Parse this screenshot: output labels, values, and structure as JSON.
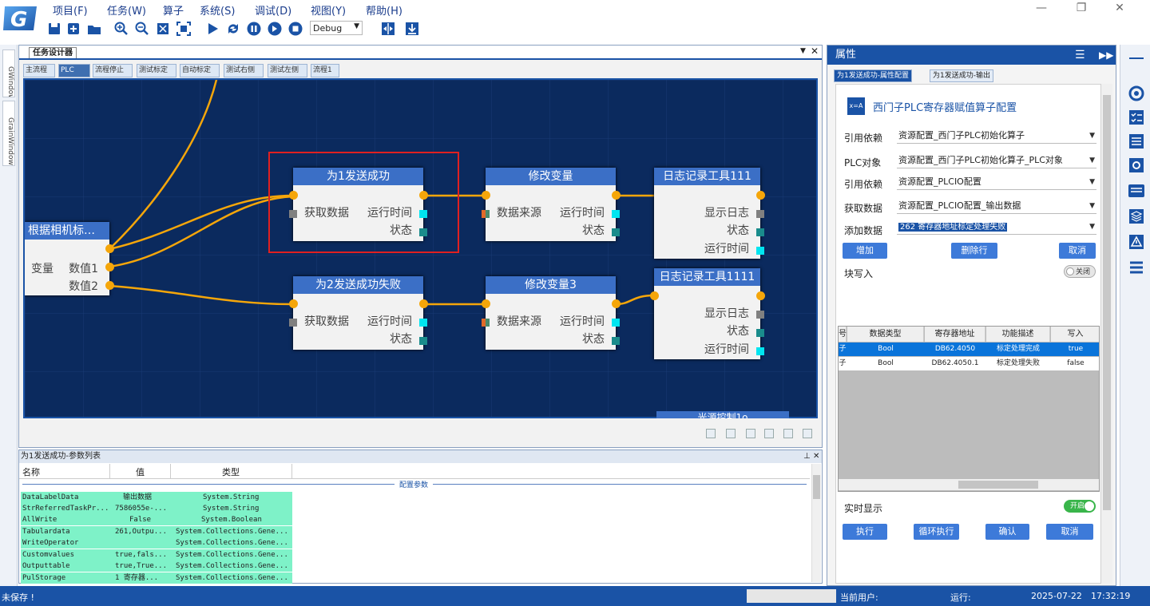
{
  "menu": {
    "items": [
      "项目(F)",
      "任务(W)",
      "算子",
      "系统(S)",
      "调试(D)",
      "视图(Y)",
      "帮助(H)"
    ]
  },
  "window_controls": {
    "minimize": "—",
    "restore": "❐",
    "close": "✕"
  },
  "toolbar": {
    "icons": [
      "save-icon",
      "add-icon",
      "open-folder-icon",
      "zoom-in-icon",
      "zoom-out-icon",
      "fit-icon",
      "fit-selection-icon",
      "run-icon",
      "loop-run-icon",
      "pause-icon",
      "step-icon",
      "stop-icon",
      "split-icon",
      "download-icon"
    ],
    "mode_value": "Debug"
  },
  "left_strip": {
    "tabs": [
      "GWindow",
      "GrainWindow1"
    ]
  },
  "designer": {
    "title": "任务设计器",
    "tabs": [
      "主流程",
      "PLC",
      "流程停止",
      "测试标定",
      "自动标定",
      "测试右侧",
      "测试左侧",
      "流程1"
    ],
    "active_tab": "PLC",
    "nodes": [
      {
        "title": "根据相机标…",
        "rows": [
          "变量",
          "数值1",
          "数值2"
        ]
      },
      {
        "title": "为1发送成功",
        "rows": [
          "获取数据",
          "运行时间",
          "状态"
        ]
      },
      {
        "title": "修改变量",
        "rows": [
          "数据来源",
          "运行时间",
          "状态"
        ]
      },
      {
        "title": "日志记录工具111",
        "rows": [
          "显示日志",
          "状态",
          "运行时间"
        ]
      },
      {
        "title": "为2发送成功失败",
        "rows": [
          "获取数据",
          "运行时间",
          "状态"
        ]
      },
      {
        "title": "修改变量3",
        "rows": [
          "数据来源",
          "运行时间",
          "状态"
        ]
      },
      {
        "title": "日志记录工具1111",
        "rows": [
          "显示日志",
          "状态",
          "运行时间"
        ]
      },
      {
        "title": "光源控制1o"
      }
    ],
    "wire_color": "#f5a60a",
    "canvas_color": "#0b2a5e"
  },
  "params": {
    "title": "为1发送成功-参数列表",
    "columns": [
      "名称",
      "值",
      "类型"
    ],
    "group_label": "配置参数",
    "rows": [
      {
        "name": "DataLabelData",
        "value": "输出数据",
        "type": "System.String"
      },
      {
        "name": "StrReferredTaskPr...",
        "value": "7586055e-...",
        "type": "System.String"
      },
      {
        "name": "AllWrite",
        "value": "False",
        "type": "System.Boolean"
      },
      {
        "name": "Tabulardata",
        "value": "261,Outpu...",
        "type": "System.Collections.Gene..."
      },
      {
        "name": "WriteOperator",
        "value": "",
        "type": "System.Collections.Gene..."
      },
      {
        "name": "Customvalues",
        "value": "true,fals...",
        "type": "System.Collections.Gene..."
      },
      {
        "name": "Outputtable",
        "value": "true,True...",
        "type": "System.Collections.Gene..."
      },
      {
        "name": "PulStorage",
        "value": "1  寄存器...",
        "type": "System.Collections.Gene..."
      }
    ]
  },
  "properties": {
    "title": "属性",
    "tabs": [
      "为1发送成功-属性配置",
      "为1发送成功-输出"
    ],
    "header": "西门子PLC寄存器赋值算子配置",
    "fields": [
      {
        "label": "引用依赖",
        "value": "资源配置_西门子PLC初始化算子"
      },
      {
        "label": "PLC对象",
        "value": "资源配置_西门子PLC初始化算子_PLC对象"
      },
      {
        "label": "引用依赖",
        "value": "资源配置_PLCIO配置"
      },
      {
        "label": "获取数据",
        "value": "资源配置_PLCIO配置_输出数据"
      },
      {
        "label": "添加数据",
        "value": "262  寄存器地址标定处理失败"
      }
    ],
    "buttons_row1": [
      "增加",
      "删除行",
      "取消"
    ],
    "block_write_label": "块写入",
    "block_write_state": "关闭",
    "grid": {
      "columns": [
        "号",
        "数据类型",
        "寄存器地址",
        "功能描述",
        "写入"
      ],
      "rows": [
        {
          "no": "子",
          "type": "Bool",
          "addr": "DB62.4050",
          "desc": "标定处理完成",
          "write": "true",
          "selected": true
        },
        {
          "no": "子",
          "type": "Bool",
          "addr": "DB62.4050.1",
          "desc": "标定处理失败",
          "write": "false",
          "selected": false
        }
      ]
    },
    "realtime_label": "实时显示",
    "realtime_state": "开启",
    "buttons_row2": [
      "执行",
      "循环执行",
      "确认",
      "取消"
    ]
  },
  "right_strip": {
    "icons": [
      "target-icon",
      "checklist-icon",
      "list-icon",
      "gear-box-icon",
      "panel-icon",
      "layers-icon",
      "warning-icon",
      "menu-list-icon"
    ]
  },
  "status": {
    "unsaved": "未保存 !",
    "user_label": "当前用户:",
    "run_label": "运行:",
    "date": "2025-07-22",
    "time": "17:32:19"
  }
}
